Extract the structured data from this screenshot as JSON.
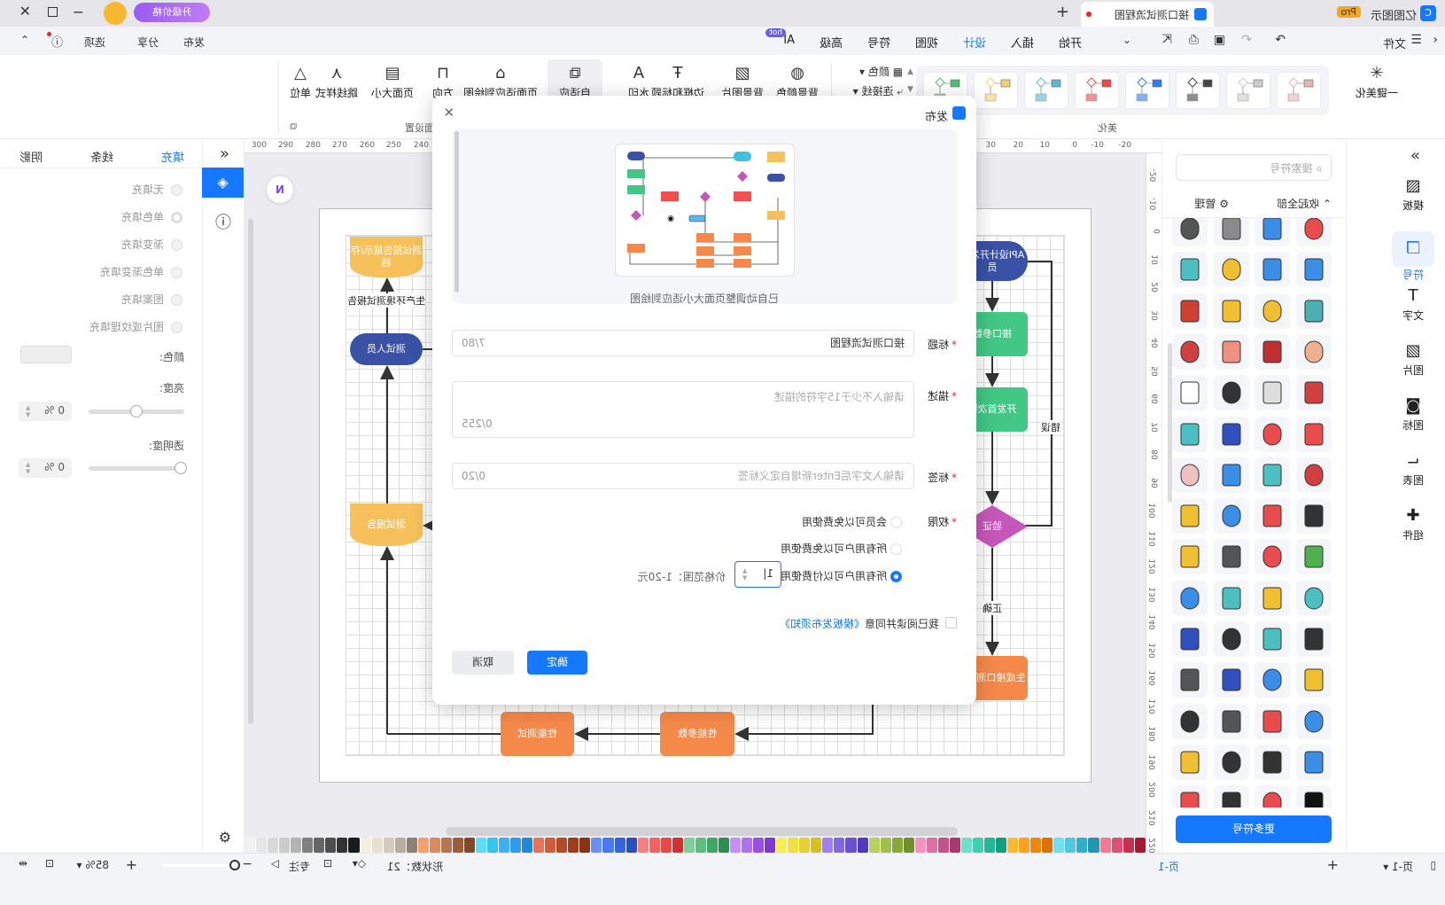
{
  "app": {
    "name": "亿图图示",
    "badge": "Pro",
    "doc_tab": "接口测试流程图",
    "new_tab": "+",
    "upgrade": "升级价格"
  },
  "menu": {
    "file": "文件",
    "tabs": [
      "开始",
      "插入",
      "设计",
      "视图",
      "符号",
      "高级",
      "AI"
    ],
    "active_tab": "设计",
    "ai_badge": "hot",
    "publish": "发布",
    "share": "分享",
    "options": "选项"
  },
  "ribbon": {
    "beautify": "一键美化",
    "theme_colors": [
      "#e8b4b4",
      "#cccccc",
      "#444444",
      "#2d7cf6",
      "#f04848",
      "#5ab8d0",
      "#f0d070",
      "#50c070"
    ],
    "color": "颜色",
    "connector": "连接线",
    "items": [
      "背景颜色",
      "背景图片",
      "边框和标题",
      "水印",
      "自适应",
      "页面适应到绘图",
      "方向",
      "页面大小",
      "跳线样式",
      "单位"
    ],
    "sections": [
      "美化",
      "页面设置"
    ]
  },
  "left_strip": {
    "items": [
      "模板",
      "符号",
      "文字",
      "图片",
      "图标",
      "图表",
      "组件"
    ],
    "active": "符号"
  },
  "symbols": {
    "search_placeholder": "搜索符号",
    "collapse_all": "收起全部",
    "manage": "管理",
    "more": "更多符号",
    "icons": [
      "ambulance",
      "flasks",
      "iv-stand",
      "crutches",
      "wheelchair",
      "iv-bag",
      "ladder",
      "foot-scale",
      "hospital-bed",
      "xray",
      "syringe",
      "intestine",
      "ear",
      "kidney",
      "stomach",
      "lungs",
      "heart",
      "nurse-cap",
      "stethoscope",
      "tooth",
      "disabled",
      "hazard",
      "stretcher",
      "medicine-bottle",
      "virus",
      "bacteria",
      "doctor",
      "nurse",
      "monitor",
      "tablet-cart",
      "monitor-chart",
      "tv",
      "phone",
      "laptop-heart",
      "tablet",
      "alarm-clock",
      "printer",
      "chat",
      "floppy",
      "router",
      "microwave",
      "ipod",
      "camera",
      "drone",
      "intercom",
      "vr-glasses",
      "dvd-player",
      "cable-box",
      "usb",
      "smartwatch",
      "watch",
      "calculator",
      "usb-stick",
      "walkie-talkie",
      "gamepad",
      "radio",
      "5g",
      "heart-red",
      "ai-chip",
      "pepper"
    ],
    "icon_colors": [
      "#e84c4c",
      "#3a8ee6",
      "#8a8a8a",
      "#555",
      "#3a8ee6",
      "#3a8ee6",
      "#f0c030",
      "#4cc0c0",
      "#4cb0b0",
      "#f0c030",
      "#f0c030",
      "#d04030",
      "#f0b090",
      "#c03030",
      "#f09080",
      "#d04040",
      "#d04040",
      "#ddd",
      "#333",
      "#fff",
      "#e84c4c",
      "#e84c4c",
      "#3050c0",
      "#4cc0c0",
      "#d04040",
      "#4cc0c0",
      "#3a8ee6",
      "#f0c0c0",
      "#333",
      "#e84c4c",
      "#3a8ee6",
      "#f0c030",
      "#50b050",
      "#e84c4c",
      "#555",
      "#f0c030",
      "#4cc0c0",
      "#f0c030",
      "#4cc0c0",
      "#3a8ee6",
      "#333",
      "#4cc0c0",
      "#333",
      "#3050c0",
      "#f0c030",
      "#3a8ee6",
      "#3050c0",
      "#555",
      "#3a8ee6",
      "#e84c4c",
      "#555",
      "#333",
      "#3a8ee6",
      "#333",
      "#333",
      "#f0c030",
      "#111",
      "#e84c4c",
      "#333",
      "#e84c4c"
    ]
  },
  "props": {
    "tabs": [
      "填充",
      "线条",
      "阴影"
    ],
    "active_tab": "填充",
    "fill_options": [
      "无填充",
      "单色填充",
      "渐变填充",
      "单色渐变填充",
      "图案填充",
      "图片或纹理填充"
    ],
    "selected_fill": "单色填充",
    "color_label": "颜色:",
    "brightness_label": "亮度:",
    "brightness_value": "0 %",
    "brightness": 0,
    "transparency_label": "透明度:",
    "transparency_value": "0 %",
    "transparency": 0
  },
  "ruler": {
    "top": [
      "-20",
      "-10",
      "0",
      "10",
      "20",
      "30",
      "40",
      "50",
      "60",
      "70",
      "80",
      "90",
      "100",
      "110",
      "120",
      "130",
      "140",
      "150",
      "160",
      "170",
      "180",
      "190",
      "200",
      "210",
      "220",
      "230",
      "240",
      "250",
      "260",
      "270",
      "280",
      "290",
      "300"
    ],
    "left": [
      "-20",
      "-10",
      "0",
      "10",
      "20",
      "30",
      "40",
      "50",
      "60",
      "70",
      "80",
      "90",
      "100",
      "110",
      "120",
      "130",
      "140",
      "150",
      "160",
      "170",
      "180",
      "190",
      "200",
      "210",
      "220",
      "230",
      "240",
      "250"
    ]
  },
  "diagram": {
    "nodes": {
      "api_dev": "API设计开发人员",
      "params": "接口参数",
      "first_verify": "开发首次验",
      "verify": "验证",
      "gen_test": "生成接口测试本",
      "perf_params": "性能参数",
      "perf_test": "性能测试",
      "tester": "测试人员",
      "report": "测试报告",
      "report_archive": "测试报告展示/存档"
    },
    "labels": {
      "wrong": "错误",
      "correct": "正确",
      "prod_report": "生产环境测试报告"
    },
    "colors": {
      "blue": "#3a52a6",
      "green": "#42c784",
      "purple": "#c657b8",
      "orange": "#f5894a",
      "yellow": "#f6c15b"
    }
  },
  "palette": [
    "#ffffff",
    "#f2f2f2",
    "#e6e6e6",
    "#d9d9d9",
    "#cccccc",
    "#b3b3b3",
    "#808080",
    "#666666",
    "#4d4d4d",
    "#333333",
    "#1a1a1a",
    "#f5efe0",
    "#e8e0d0",
    "#d4cbb8",
    "#b8ae9c",
    "#8c8173",
    "#f4a06c",
    "#d98a5e",
    "#b87350",
    "#9c5c3c",
    "#7d4a2e",
    "#5bdcf7",
    "#36c5f0",
    "#3eb0f7",
    "#2d9cf0",
    "#1b8ad8",
    "#e8735a",
    "#d45a3c",
    "#b8482a",
    "#a03c1e",
    "#8a3214",
    "#6a8ff7",
    "#4a78f0",
    "#3563e0",
    "#2750c8",
    "#f98080",
    "#f56060",
    "#e84848",
    "#d43030",
    "#7ed09a",
    "#5cbf7e",
    "#3fa864",
    "#2a9050",
    "#c890f5",
    "#b070f0",
    "#9850e0",
    "#8038d0",
    "#f5f050",
    "#f0e040",
    "#e8d030",
    "#d8c020",
    "#a080f0",
    "#8068e0",
    "#6850d0",
    "#5038c0",
    "#b8d060",
    "#a0c048",
    "#88a838",
    "#70902a",
    "#f890c0",
    "#e070a0",
    "#c85088",
    "#a83870",
    "#70e0c8",
    "#40d0b0",
    "#20b898",
    "#10a080",
    "#ffb830",
    "#ffa020",
    "#f08810",
    "#e07000",
    "#70e0f0",
    "#50c8e0",
    "#30b0c8",
    "#2098b0",
    "#f87890",
    "#e05070",
    "#c83050",
    "#a81830"
  ],
  "status": {
    "page_select": "页-1",
    "add": "+",
    "page_tab": "页-1",
    "shapes": "形状数：21",
    "focus": "专注",
    "zoom": "85%",
    "zoom_minus": "−",
    "zoom_plus": "+"
  },
  "dialog": {
    "title": "发布",
    "preview_caption": "已自动调整页面大小适应到绘图",
    "title_label": "标题",
    "title_value": "接口测试流程图",
    "title_count": "7/80",
    "desc_label": "描述",
    "desc_placeholder": "请输入不少于15字符的描述",
    "desc_count": "0/255",
    "tag_label": "标签",
    "tag_placeholder": "请输入文字后Enter新增自定义标签",
    "tag_count": "0/20",
    "perm_label": "权限",
    "perm_options": [
      "会员可以免费使用",
      "所有用户可以免费使用",
      "所有用户可以付费使用"
    ],
    "perm_selected": "所有用户可以付费使用",
    "price_value": "1",
    "price_range": "价格范围：1-20元",
    "agree_text": "我已阅读并同意",
    "agree_link": "《模板发布须知》",
    "agree_checked": false,
    "confirm": "确定",
    "cancel": "取消",
    "accent": "#1677ff"
  }
}
